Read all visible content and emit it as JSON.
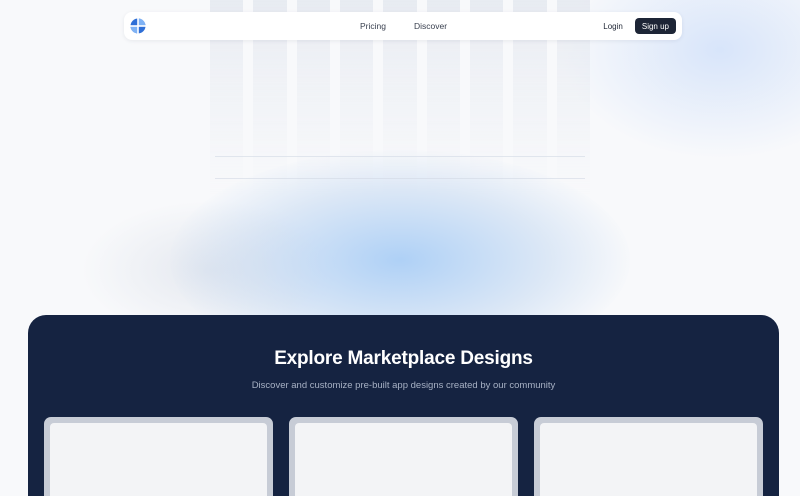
{
  "nav": {
    "logo_icon": "pinwheel-logo-icon",
    "links": [
      {
        "label": "Pricing"
      },
      {
        "label": "Discover"
      }
    ],
    "login_label": "Login",
    "signup_label": "Sign up"
  },
  "marketplace": {
    "title": "Explore Marketplace Designs",
    "subtitle": "Discover and customize pre-built app designs created by our community",
    "cards": [
      {
        "name": "design-card-1"
      },
      {
        "name": "design-card-2"
      },
      {
        "name": "design-card-3"
      }
    ]
  },
  "colors": {
    "accent_dark": "#152341",
    "button_dark": "#1d2536",
    "logo_blue": "#3b82f6"
  }
}
